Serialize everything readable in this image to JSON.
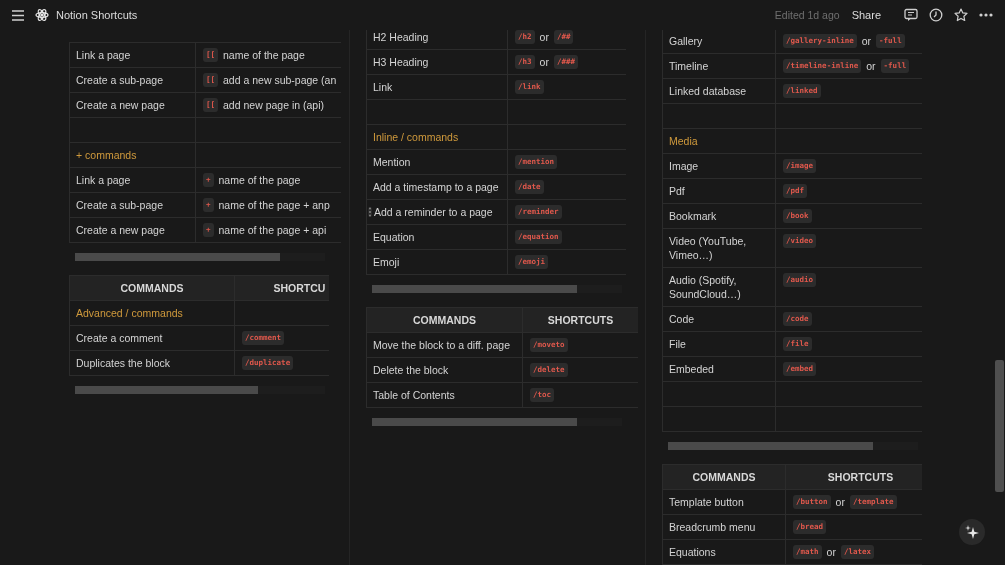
{
  "topbar": {
    "title": "Notion Shortcuts",
    "edited": "Edited 1d ago",
    "share": "Share"
  },
  "columns": [
    {
      "tables": [
        {
          "rows": [
            {
              "kind": "entry",
              "command": "Link a page",
              "shortcut": [
                {
                  "kind": "code",
                  "text": "[["
                },
                {
                  "kind": "text",
                  "text": "name of the page"
                }
              ]
            },
            {
              "kind": "entry",
              "command": "Create a sub-page",
              "shortcut": [
                {
                  "kind": "code",
                  "text": "[["
                },
                {
                  "kind": "text",
                  "text": "add a new sub-page (an"
                }
              ]
            },
            {
              "kind": "entry",
              "command": "Create a new page",
              "shortcut": [
                {
                  "kind": "code",
                  "text": "[["
                },
                {
                  "kind": "text",
                  "text": "add new page in (api)"
                }
              ]
            },
            {
              "kind": "empty"
            },
            {
              "kind": "section",
              "title": "+ commands"
            },
            {
              "kind": "entry",
              "command": "Link a page",
              "shortcut": [
                {
                  "kind": "code",
                  "text": "+"
                },
                {
                  "kind": "text",
                  "text": "name of the page"
                }
              ]
            },
            {
              "kind": "entry",
              "command": "Create a sub-page",
              "shortcut": [
                {
                  "kind": "code",
                  "text": "+"
                },
                {
                  "kind": "text",
                  "text": "name of the page + anp"
                }
              ]
            },
            {
              "kind": "entry",
              "command": "Create a new page",
              "shortcut": [
                {
                  "kind": "code",
                  "text": "+"
                },
                {
                  "kind": "text",
                  "text": "name of the page + api"
                }
              ]
            }
          ]
        },
        {
          "header": [
            "COMMANDS",
            "SHORTCU"
          ],
          "rows": [
            {
              "kind": "section",
              "title": "Advanced / commands"
            },
            {
              "kind": "entry",
              "command": "Create a comment",
              "shortcut": [
                {
                  "kind": "code",
                  "text": "/comment"
                }
              ]
            },
            {
              "kind": "entry",
              "command": "Duplicates the block",
              "shortcut": [
                {
                  "kind": "code",
                  "text": "/duplicate"
                }
              ]
            }
          ]
        }
      ]
    },
    {
      "tables": [
        {
          "rows": [
            {
              "kind": "entry",
              "command": "H2 Heading",
              "shortcut": [
                {
                  "kind": "code",
                  "text": "/h2"
                },
                {
                  "kind": "text",
                  "text": "or"
                },
                {
                  "kind": "code",
                  "text": "/##"
                }
              ]
            },
            {
              "kind": "entry",
              "command": "H3 Heading",
              "shortcut": [
                {
                  "kind": "code",
                  "text": "/h3"
                },
                {
                  "kind": "text",
                  "text": "or"
                },
                {
                  "kind": "code",
                  "text": "/###"
                }
              ]
            },
            {
              "kind": "entry",
              "command": "Link",
              "shortcut": [
                {
                  "kind": "code",
                  "text": "/link"
                }
              ]
            },
            {
              "kind": "empty"
            },
            {
              "kind": "section",
              "title": "Inline / commands"
            },
            {
              "kind": "entry",
              "command": "Mention",
              "shortcut": [
                {
                  "kind": "code",
                  "text": "/mention"
                }
              ]
            },
            {
              "kind": "entry",
              "command": "Add a timestamp to a page",
              "shortcut": [
                {
                  "kind": "code",
                  "text": "/date"
                }
              ]
            },
            {
              "kind": "entry",
              "command": "Add a reminder to a page",
              "handle": true,
              "shortcut": [
                {
                  "kind": "code",
                  "text": "/reminder"
                }
              ]
            },
            {
              "kind": "entry",
              "command": "Equation",
              "shortcut": [
                {
                  "kind": "code",
                  "text": "/equation"
                }
              ]
            },
            {
              "kind": "entry",
              "command": "Emoji",
              "shortcut": [
                {
                  "kind": "code",
                  "text": "/emoji"
                }
              ]
            }
          ]
        },
        {
          "header": [
            "COMMANDS",
            "SHORTCUTS"
          ],
          "rows": [
            {
              "kind": "entry",
              "command": "Move the block to a diff. page",
              "shortcut": [
                {
                  "kind": "code",
                  "text": "/moveto"
                }
              ]
            },
            {
              "kind": "entry",
              "command": "Delete the block",
              "shortcut": [
                {
                  "kind": "code",
                  "text": "/delete"
                }
              ]
            },
            {
              "kind": "entry",
              "command": "Table of Contents",
              "shortcut": [
                {
                  "kind": "code",
                  "text": "/toc"
                }
              ]
            }
          ]
        }
      ]
    },
    {
      "tables": [
        {
          "rows": [
            {
              "kind": "entry",
              "command": "Gallery",
              "shortcut": [
                {
                  "kind": "code",
                  "text": "/gallery-inline"
                },
                {
                  "kind": "text",
                  "text": "or"
                },
                {
                  "kind": "code",
                  "text": "-full"
                }
              ]
            },
            {
              "kind": "entry",
              "command": "Timeline",
              "shortcut": [
                {
                  "kind": "code",
                  "text": "/timeline-inline"
                },
                {
                  "kind": "text",
                  "text": "or"
                },
                {
                  "kind": "code",
                  "text": "-full"
                }
              ]
            },
            {
              "kind": "entry",
              "command": "Linked database",
              "shortcut": [
                {
                  "kind": "code",
                  "text": "/linked"
                }
              ]
            },
            {
              "kind": "empty"
            },
            {
              "kind": "section",
              "title": "Media"
            },
            {
              "kind": "entry",
              "command": "Image",
              "shortcut": [
                {
                  "kind": "code",
                  "text": "/image"
                }
              ]
            },
            {
              "kind": "entry",
              "command": "Pdf",
              "shortcut": [
                {
                  "kind": "code",
                  "text": "/pdf"
                }
              ]
            },
            {
              "kind": "entry",
              "command": "Bookmark",
              "shortcut": [
                {
                  "kind": "code",
                  "text": "/book"
                }
              ]
            },
            {
              "kind": "entry",
              "command": "Video (YouTube, Vimeo…)",
              "shortcut": [
                {
                  "kind": "code",
                  "text": "/video"
                }
              ]
            },
            {
              "kind": "entry",
              "command": "Audio (Spotify, SoundCloud…)",
              "shortcut": [
                {
                  "kind": "code",
                  "text": "/audio"
                }
              ]
            },
            {
              "kind": "entry",
              "command": "Code",
              "shortcut": [
                {
                  "kind": "code",
                  "text": "/code"
                }
              ]
            },
            {
              "kind": "entry",
              "command": "File",
              "shortcut": [
                {
                  "kind": "code",
                  "text": "/file"
                }
              ]
            },
            {
              "kind": "entry",
              "command": "Embeded",
              "shortcut": [
                {
                  "kind": "code",
                  "text": "/embed"
                }
              ]
            },
            {
              "kind": "empty"
            },
            {
              "kind": "empty"
            }
          ]
        },
        {
          "header": [
            "COMMANDS",
            "SHORTCUTS"
          ],
          "rows": [
            {
              "kind": "entry",
              "command": "Template button",
              "shortcut": [
                {
                  "kind": "code",
                  "text": "/button"
                },
                {
                  "kind": "text",
                  "text": "or"
                },
                {
                  "kind": "code",
                  "text": "/template"
                }
              ]
            },
            {
              "kind": "entry",
              "command": "Breadcrumb menu",
              "shortcut": [
                {
                  "kind": "code",
                  "text": "/bread"
                }
              ]
            },
            {
              "kind": "entry",
              "command": "Equations",
              "shortcut": [
                {
                  "kind": "code",
                  "text": "/math"
                },
                {
                  "kind": "text",
                  "text": "or"
                },
                {
                  "kind": "code",
                  "text": "/latex"
                }
              ]
            }
          ]
        }
      ]
    }
  ]
}
